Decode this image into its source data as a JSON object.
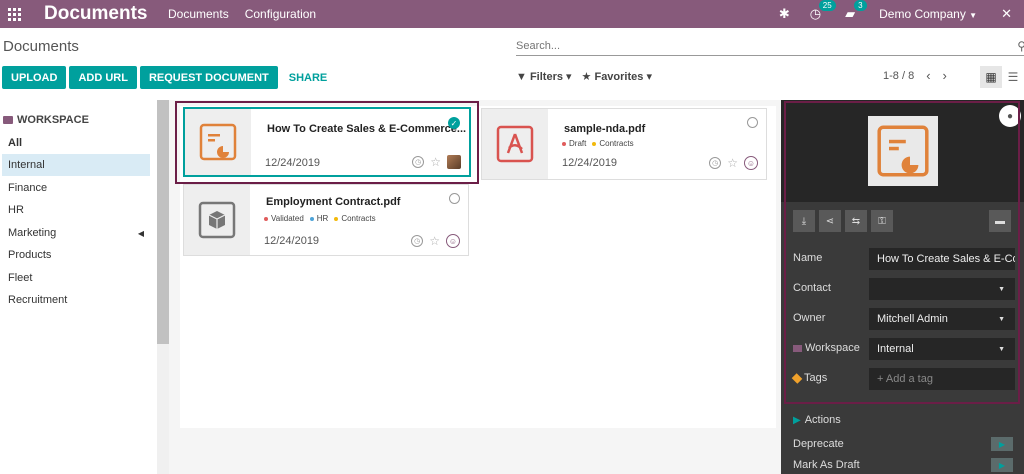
{
  "navbar": {
    "app_title": "Documents",
    "menu": [
      "Documents",
      "Configuration"
    ],
    "activity_count": "25",
    "messages_count": "3",
    "company": "Demo Company"
  },
  "control_panel": {
    "page_title": "Documents",
    "search_placeholder": "Search...",
    "buttons": [
      "UPLOAD",
      "ADD URL",
      "REQUEST DOCUMENT"
    ],
    "share_label": "SHARE",
    "filters_label": "Filters",
    "favorites_label": "Favorites",
    "pager": "1-8 / 8"
  },
  "sidebar": {
    "header": "WORKSPACE",
    "items": [
      "All",
      "Internal",
      "Finance",
      "HR",
      "Marketing",
      "Products",
      "Fleet",
      "Recruitment"
    ]
  },
  "cards": [
    {
      "name": "How To Create Sales & E-Commerce...",
      "date": "12/24/2019",
      "tags": []
    },
    {
      "name": "sample-nda.pdf",
      "date": "12/24/2019",
      "tags": [
        {
          "label": "Draft",
          "color": "#e05c5c"
        },
        {
          "label": "Contracts",
          "color": "#f2b90c"
        }
      ]
    },
    {
      "name": "Employment Contract.pdf",
      "date": "12/24/2019",
      "tags": [
        {
          "label": "Validated",
          "color": "#e05c5c"
        },
        {
          "label": "HR",
          "color": "#4ea3d8"
        },
        {
          "label": "Contracts",
          "color": "#f2b90c"
        }
      ]
    }
  ],
  "details": {
    "name_label": "Name",
    "name_value": "How To Create Sales & E-Co",
    "contact_label": "Contact",
    "contact_value": "",
    "owner_label": "Owner",
    "owner_value": "Mitchell Admin",
    "workspace_label": "Workspace",
    "workspace_value": "Internal",
    "tags_label": "Tags",
    "tags_placeholder": "+ Add a tag",
    "actions_label": "Actions",
    "actions": [
      "Deprecate",
      "Mark As Draft"
    ]
  },
  "colors": {
    "brand": "#875a7b",
    "accent": "#00a09d",
    "highlight": "#6b1e47",
    "doc_icon": "#e0823a"
  }
}
